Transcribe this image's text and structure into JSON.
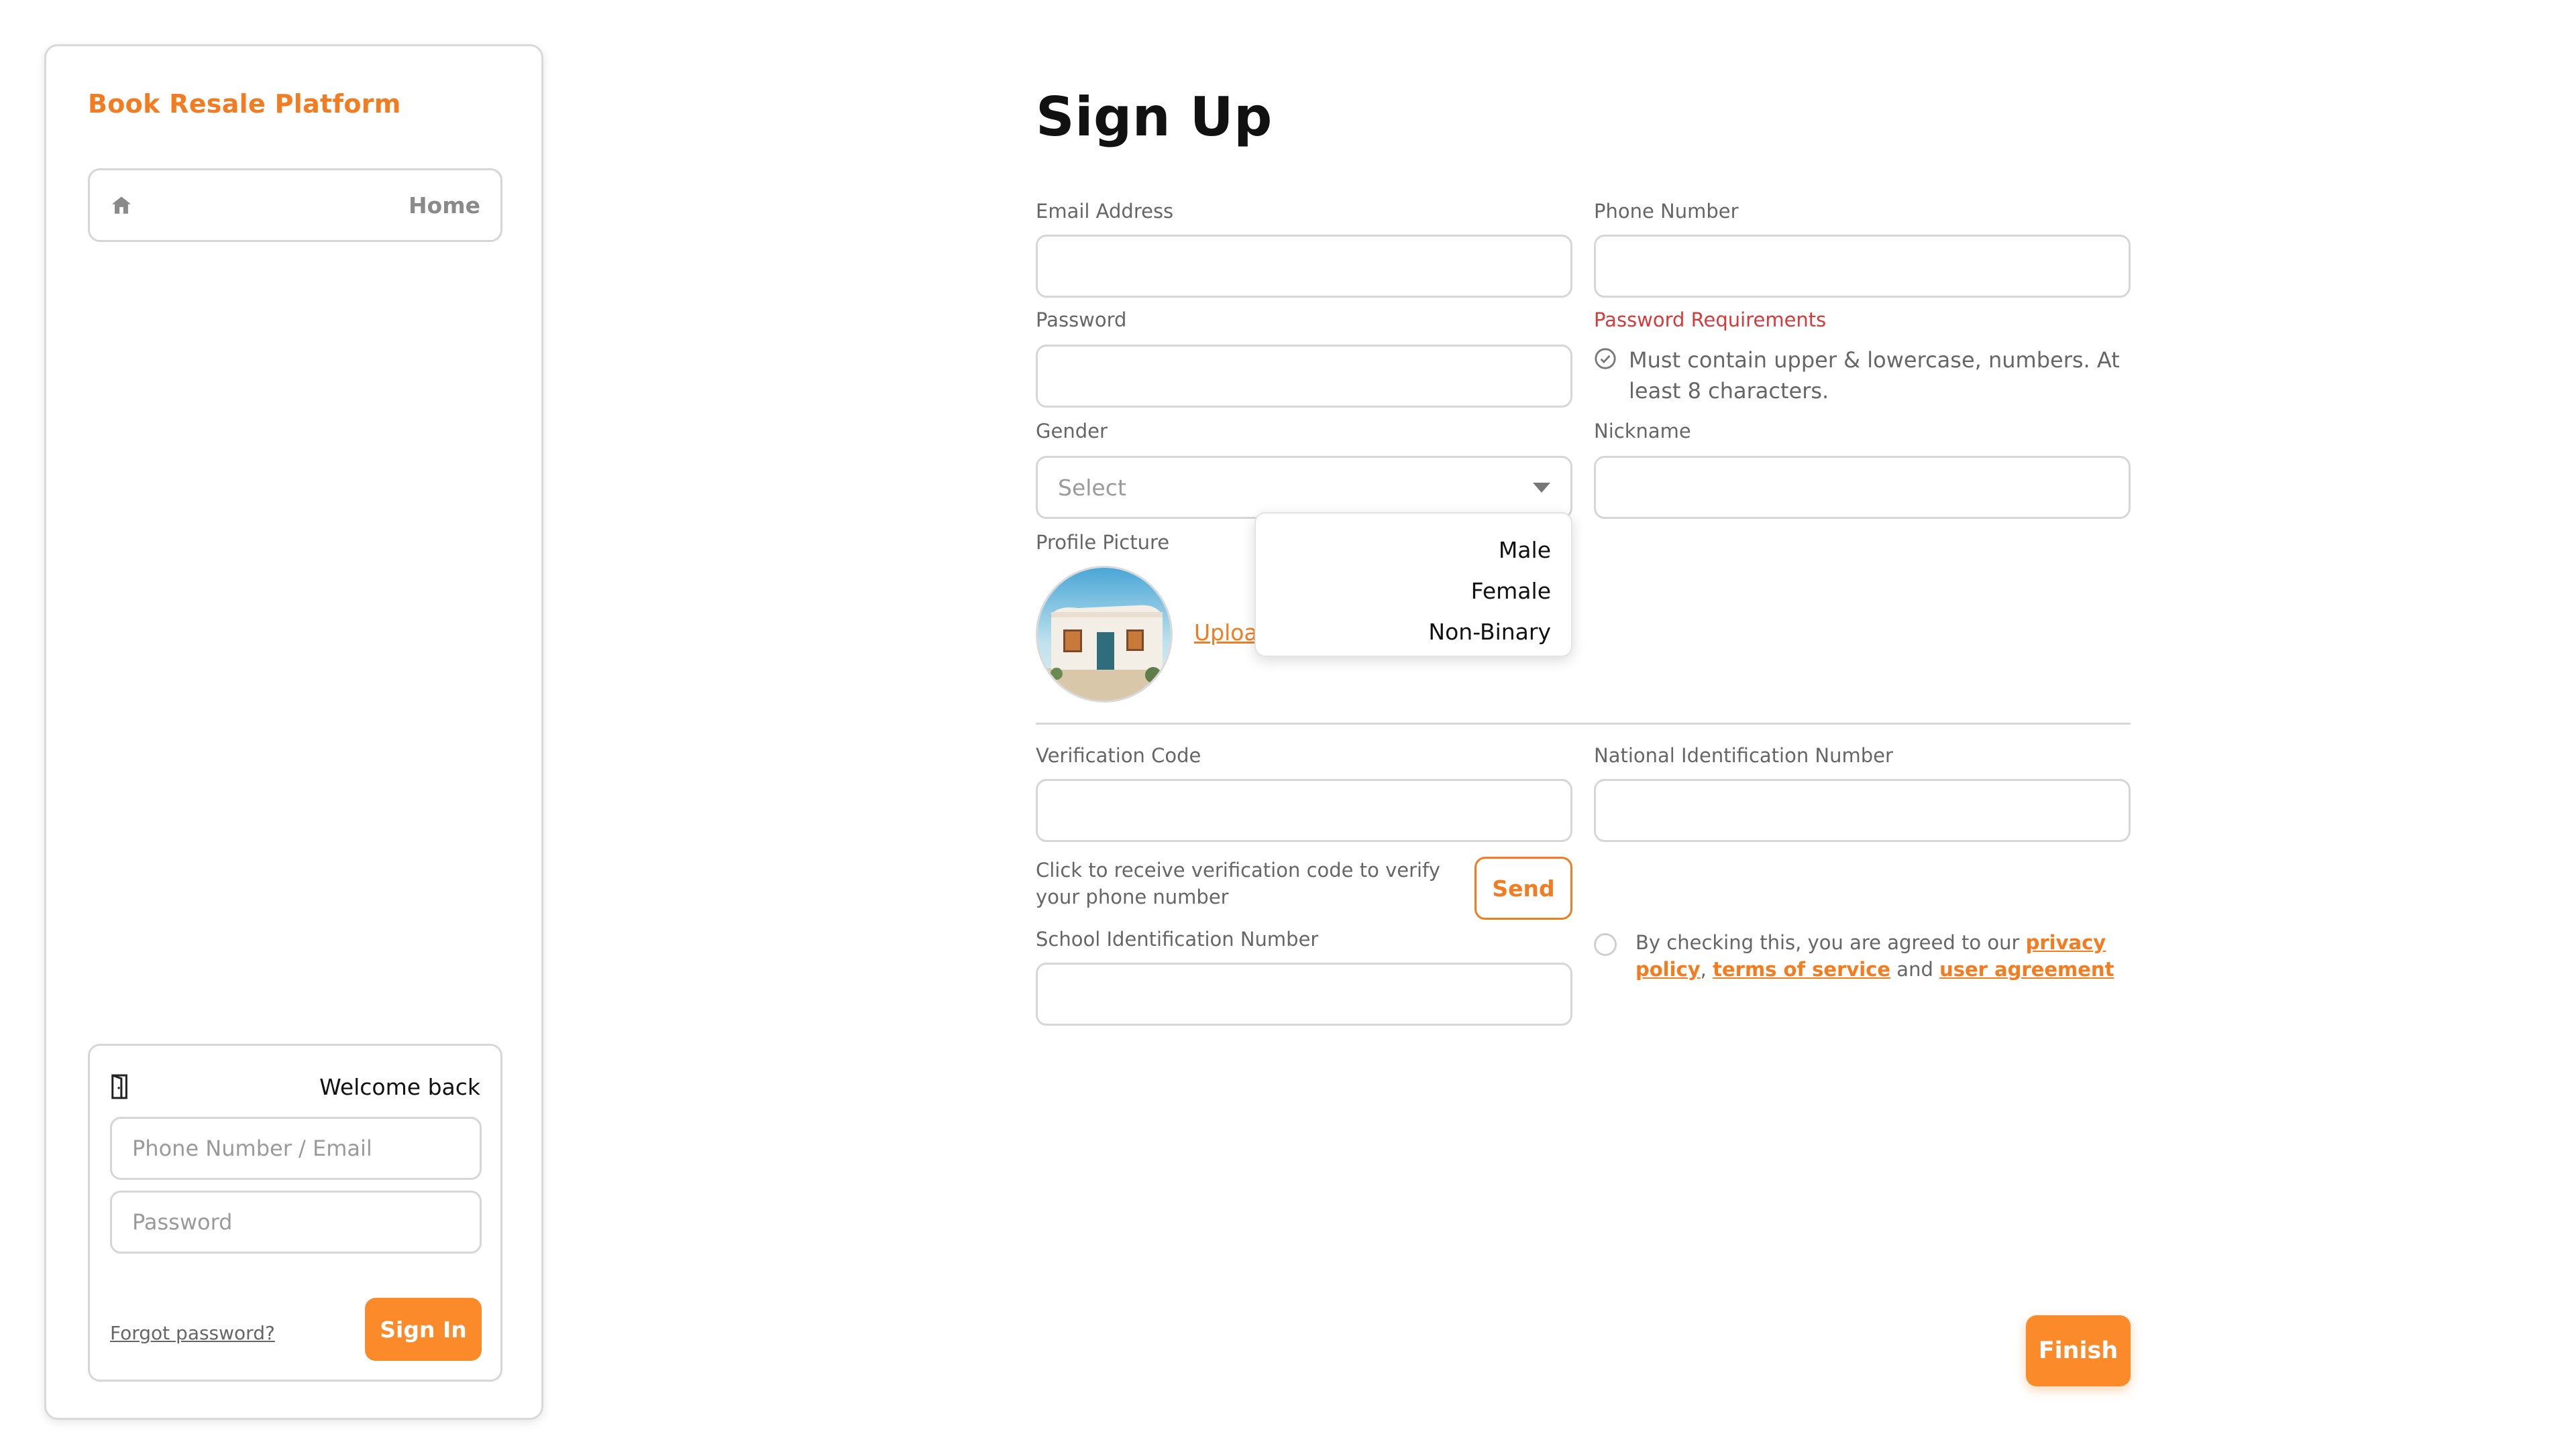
{
  "sidebar": {
    "brand": "Book Resale Platform",
    "nav": {
      "home_label": "Home",
      "home_icon": "home-icon"
    },
    "login": {
      "title": "Welcome back",
      "door_icon": "door-icon",
      "identifier_placeholder": "Phone Number / Email",
      "password_placeholder": "Password",
      "forgot_label": "Forgot password?",
      "signin_label": "Sign In"
    }
  },
  "form": {
    "title": "Sign Up",
    "email": {
      "label": "Email Address",
      "value": ""
    },
    "phone": {
      "label": "Phone Number",
      "value": ""
    },
    "password": {
      "label": "Password",
      "value": ""
    },
    "password_requirements": {
      "label": "Password Requirements",
      "text": "Must contain upper & lowercase, numbers. At least 8 characters."
    },
    "gender": {
      "label": "Gender",
      "selected": "Select",
      "options": [
        "Male",
        "Female",
        "Non-Binary"
      ]
    },
    "nickname": {
      "label": "Nickname",
      "value": ""
    },
    "profile_picture": {
      "label": "Profile Picture",
      "upload_label": "Upload"
    },
    "verification_code": {
      "label": "Verification Code",
      "value": "",
      "hint": "Click to receive verification code to verify your phone number",
      "send_label": "Send"
    },
    "national_id": {
      "label": "National Identification Number",
      "value": ""
    },
    "school_id": {
      "label": "School Identification Number",
      "value": ""
    },
    "agreement": {
      "prefix": "By checking this, you are agreed to our ",
      "privacy_policy": "privacy policy",
      "sep1": ", ",
      "terms": "terms of service",
      "sep2": " and ",
      "user_agreement": "user agreement"
    },
    "finish_label": "Finish"
  },
  "colors": {
    "accent": "#f47c20",
    "button": "#fb8a2a",
    "error": "#d83a3a",
    "border": "#d6d6d6"
  }
}
